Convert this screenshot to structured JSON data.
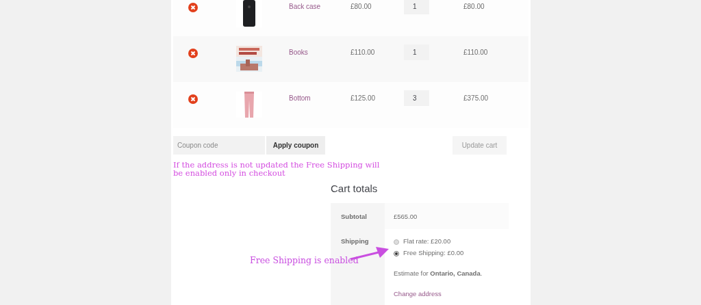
{
  "cart_items": [
    {
      "name": "Back case",
      "price": "£80.00",
      "quantity": "1",
      "subtotal": "£80.00",
      "kind": "phone"
    },
    {
      "name": "Books",
      "price": "£110.00",
      "quantity": "1",
      "subtotal": "£110.00",
      "kind": "book"
    },
    {
      "name": "Bottom",
      "price": "£125.00",
      "quantity": "3",
      "subtotal": "£375.00",
      "kind": "trousers"
    }
  ],
  "coupon": {
    "placeholder": "Coupon code",
    "apply_button": "Apply coupon"
  },
  "update_button": "Update cart",
  "note": "If the address is not updated the Free Shipping will be enabled only in checkout",
  "cart_totals": {
    "title": "Cart totals",
    "subtotal_label": "Subtotal",
    "subtotal_value": "£565.00",
    "shipping_label": "Shipping",
    "shipping_options": [
      {
        "label": "Flat rate: £20.00",
        "selected": false
      },
      {
        "label": "Free Shipping: £0.00",
        "selected": true
      }
    ],
    "estimate": "Estimate for **Ontario, Canada**.",
    "change_address": "Change address"
  },
  "annotation": "Free Shipping is enabled"
}
